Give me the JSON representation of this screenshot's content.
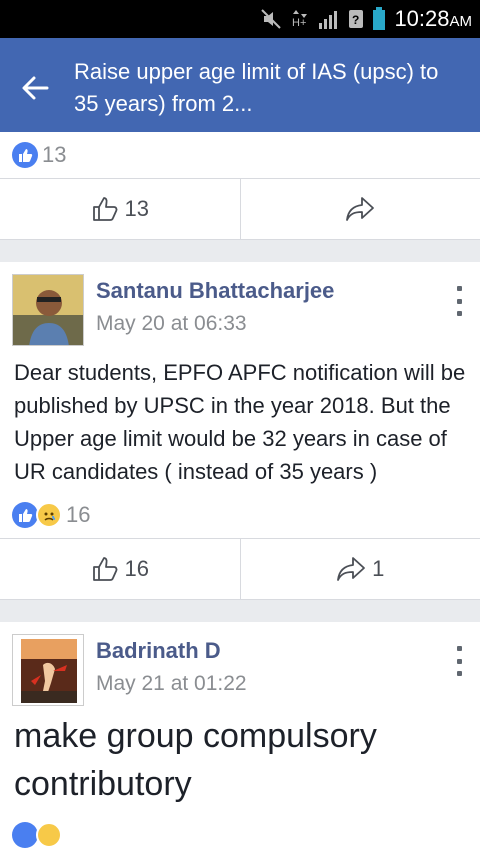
{
  "status_bar": {
    "time": "10:28",
    "ampm": "AM"
  },
  "header": {
    "title": "Raise upper age limit of IAS (upsc) to 35 years) from 2..."
  },
  "top_card": {
    "reaction_count": "13",
    "like_count": "13"
  },
  "posts": [
    {
      "author": "Santanu Bhattacharjee",
      "date": "May 20 at 06:33",
      "text": "Dear students, EPFO APFC notification will be published by UPSC in the year 2018. But the Upper age limit would be 32 years in case of UR candidates ( instead of 35 years )",
      "reaction_count": "16",
      "like_count": "16",
      "share_count": "1"
    },
    {
      "author": "Badrinath D",
      "date": "May 21 at 01:22",
      "text": "make group compulsory contributory"
    }
  ],
  "colors": {
    "header": "#4267b2",
    "author": "#4b5b8a",
    "like": "#4a7ff0"
  },
  "icons": [
    "back-arrow-icon",
    "like-icon",
    "share-icon",
    "more-icon",
    "mute-icon",
    "signal-icon",
    "battery-icon"
  ]
}
